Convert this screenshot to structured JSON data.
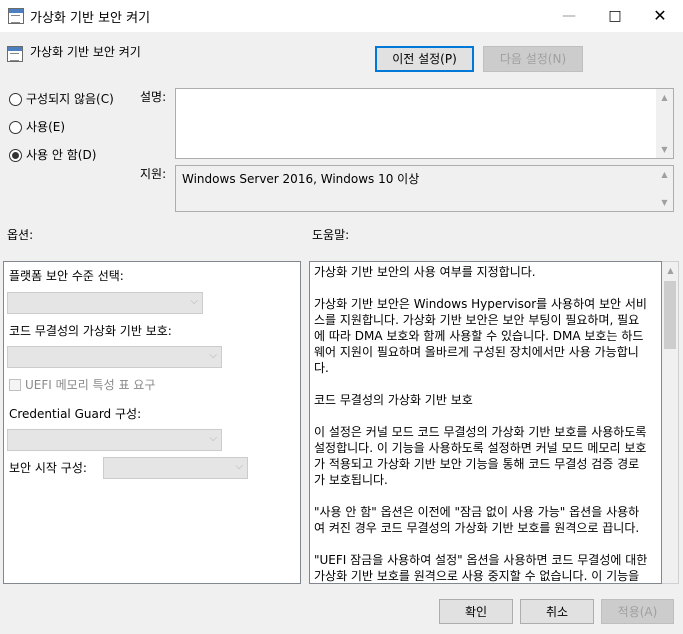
{
  "window": {
    "title": "가상화 기반 보안 켜기"
  },
  "header": {
    "policy_title": "가상화 기반 보안 켜기",
    "prev_button": "이전 설정(P)",
    "next_button": "다음 설정(N)"
  },
  "state": {
    "options": [
      {
        "label": "구성되지 않음(C)",
        "selected": false
      },
      {
        "label": "사용(E)",
        "selected": false
      },
      {
        "label": "사용 안 함(D)",
        "selected": true
      }
    ]
  },
  "comment": {
    "label": "설명:",
    "value": ""
  },
  "supported": {
    "label": "지원:",
    "value": "Windows Server 2016, Windows 10 이상"
  },
  "options_section": {
    "label": "옵션:",
    "platform_label": "플랫폼 보안 수준 선택:",
    "code_integrity_label": "코드 무결성의 가상화 기반 보호:",
    "uefi_mat_label": "UEFI 메모리 특성 표 요구",
    "credential_guard_label": "Credential  Guard 구성:",
    "secure_launch_label": "보안 시작 구성:"
  },
  "help_section": {
    "label": "도움말:",
    "text": "가상화 기반 보안의 사용 여부를 지정합니다.\n\n가상화 기반 보안은 Windows Hypervisor를 사용하여 보안 서비스를 지원합니다. 가상화 기반 보안은 보안 부팅이 필요하며, 필요에 따라 DMA 보호와 함께 사용할 수 있습니다. DMA 보호는 하드웨어 지원이 필요하며 올바르게 구성된 장치에서만 사용 가능합니다.\n\n코드 무결성의 가상화 기반 보호\n\n이 설정은 커널 모드 코드 무결성의 가상화 기반 보호를 사용하도록 설정합니다. 이 기능을 사용하도록 설정하면 커널 모드 메모리 보호가 적용되고 가상화 기반 보안 기능을 통해 코드 무결성 검증 경로가 보호됩니다.\n\n\"사용 안 함\" 옵션은 이전에 \"잠금 없이 사용 가능\" 옵션을 사용하여 켜진 경우 코드 무결성의 가상화 기반 보호를 원격으로 끕니다.\n\n\"UEFI 잠금을 사용하여 설정\" 옵션을 사용하면 코드 무결성에 대한 가상화 기반 보호를 원격으로 사용 중지할 수 없습니다. 이 기능을 사용하지 않도록 설정하려면 그룹 정책을 \"사용 안 함\"으로 설정하고"
  },
  "footer": {
    "ok": "확인",
    "cancel": "취소",
    "apply": "적용(A)"
  },
  "colors": {
    "accent": "#0078d7",
    "window_bg": "#f0f0f0"
  }
}
